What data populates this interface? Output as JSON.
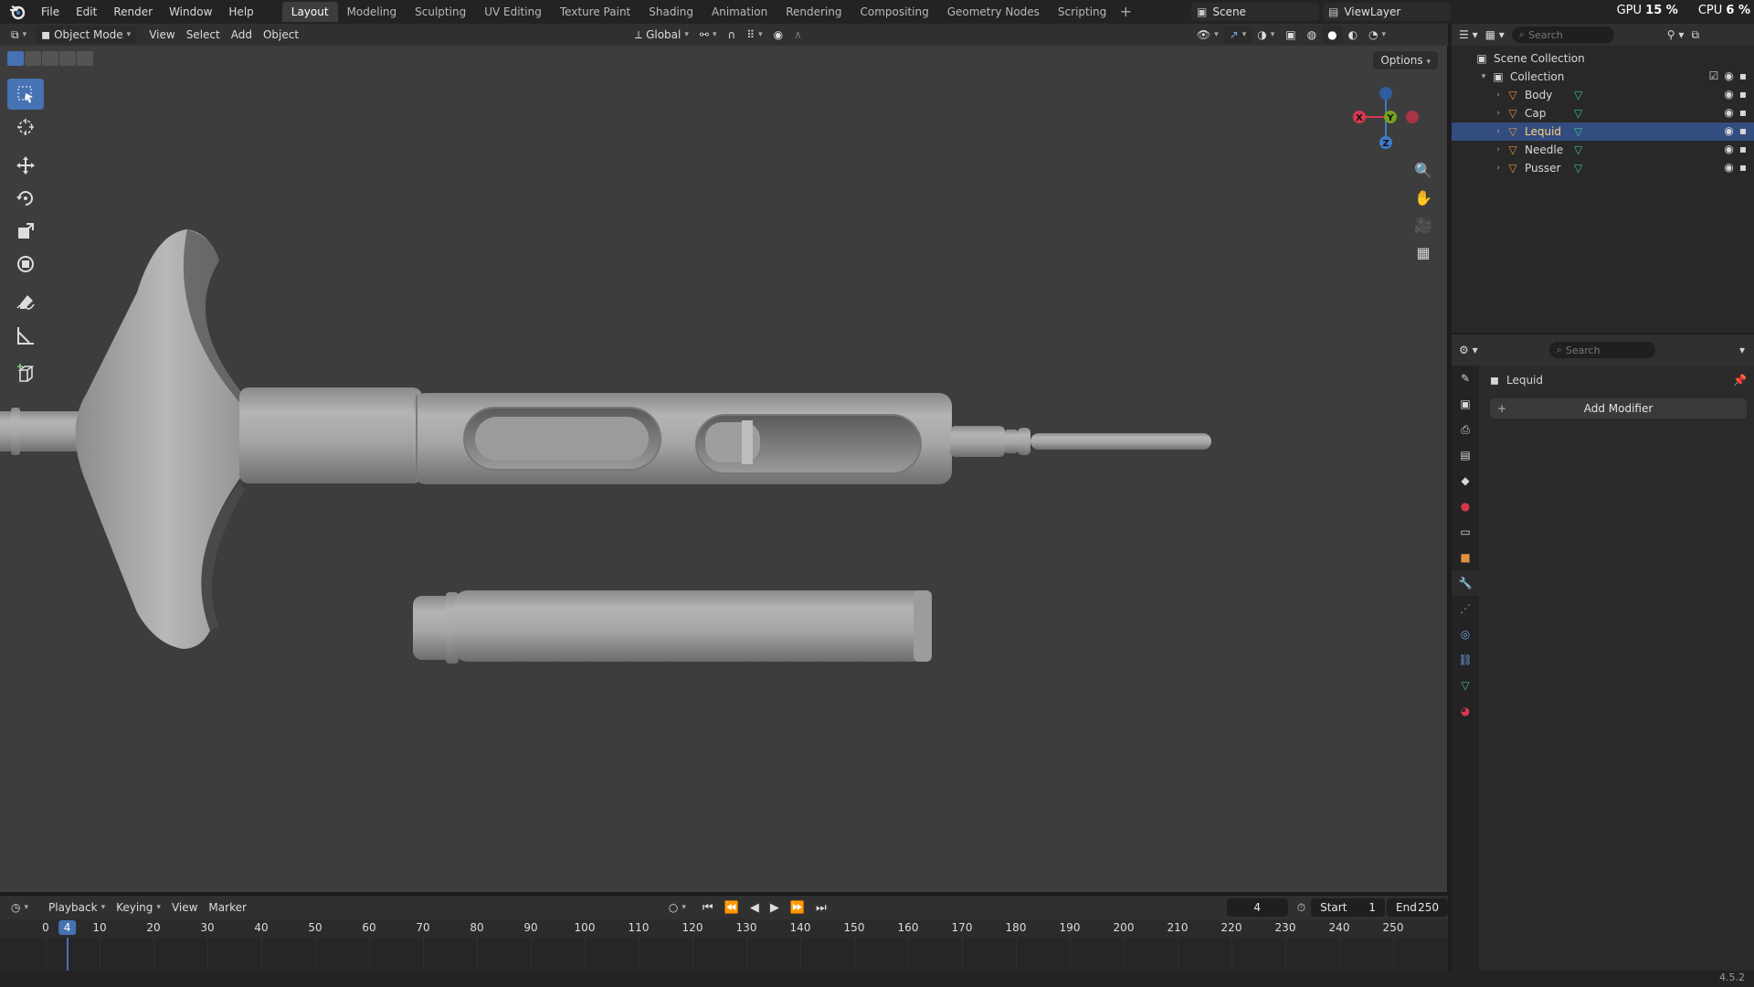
{
  "menu": [
    "File",
    "Edit",
    "Render",
    "Window",
    "Help"
  ],
  "workspaces": [
    "Layout",
    "Modeling",
    "Sculpting",
    "UV Editing",
    "Texture Paint",
    "Shading",
    "Animation",
    "Rendering",
    "Compositing",
    "Geometry Nodes",
    "Scripting"
  ],
  "active_workspace": "Layout",
  "scene_name": "Scene",
  "view_layer": "ViewLayer",
  "stats": {
    "gpu_label": "GPU",
    "gpu_value": "15 %",
    "cpu_label": "CPU",
    "cpu_value": "6 %"
  },
  "viewport": {
    "mode": "Object Mode",
    "menus": [
      "View",
      "Select",
      "Add",
      "Object"
    ],
    "orientation": "Global",
    "options_label": "Options"
  },
  "gizmo": {
    "x": "X",
    "y": "Y",
    "z": "Z"
  },
  "outliner": {
    "search_placeholder": "Search",
    "scene_collection": "Scene Collection",
    "collection": "Collection",
    "objects": [
      "Body",
      "Cap",
      "Lequid",
      "Needle",
      "Pusser"
    ],
    "selected": "Lequid"
  },
  "properties": {
    "search_placeholder": "Search",
    "object_name": "Lequid",
    "add_modifier": "Add Modifier"
  },
  "timeline": {
    "menus": [
      "Playback",
      "Keying",
      "View",
      "Marker"
    ],
    "current_frame": "4",
    "start_label": "Start",
    "start": "1",
    "end_label": "End",
    "end": "250",
    "ticks": [
      "0",
      "10",
      "20",
      "30",
      "40",
      "50",
      "60",
      "70",
      "80",
      "90",
      "100",
      "110",
      "120",
      "130",
      "140",
      "150",
      "160",
      "170",
      "180",
      "190",
      "200",
      "210",
      "220",
      "230",
      "240",
      "250"
    ],
    "playhead": "4"
  },
  "version": "4.5.2",
  "colors": {
    "accent": "#4772b3",
    "viewport_bg": "#3d3d3d",
    "x_axis": "#d5384c",
    "y_axis": "#76a022",
    "z_axis": "#3f79c8",
    "mesh_icon": "#e09040",
    "mesh_data_icon": "#3fbf8f"
  }
}
